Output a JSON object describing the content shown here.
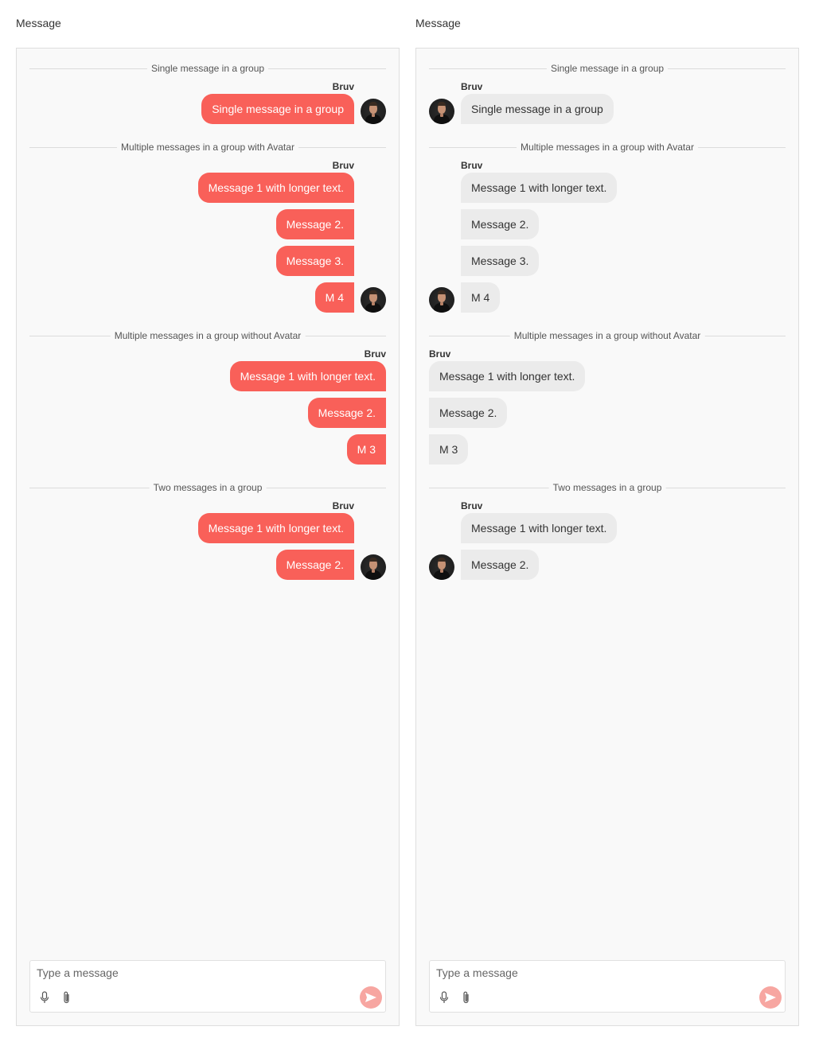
{
  "panels": [
    {
      "title": "Message",
      "variant": "outgoing",
      "sections": [
        {
          "divider": "Single message in a group",
          "name": "Bruv",
          "messages": [
            "Single message in a group"
          ],
          "avatar": true
        },
        {
          "divider": "Multiple messages in a group with Avatar",
          "name": "Bruv",
          "messages": [
            "Message 1 with longer text.",
            "Message 2.",
            "Message 3.",
            "M 4"
          ],
          "avatar": true
        },
        {
          "divider": "Multiple messages in a group without Avatar",
          "name": "Bruv",
          "messages": [
            "Message 1 with longer text.",
            "Message 2.",
            "M 3"
          ],
          "avatar": false
        },
        {
          "divider": "Two messages in a group",
          "name": "Bruv",
          "messages": [
            "Message 1 with longer text.",
            "Message 2."
          ],
          "avatar": true
        }
      ],
      "composer": {
        "placeholder": "Type a message"
      }
    },
    {
      "title": "Message",
      "variant": "incoming",
      "sections": [
        {
          "divider": "Single message in a group",
          "name": "Bruv",
          "messages": [
            "Single message in a group"
          ],
          "avatar": true
        },
        {
          "divider": "Multiple messages in a group with Avatar",
          "name": "Bruv",
          "messages": [
            "Message 1 with longer text.",
            "Message 2.",
            "Message 3.",
            "M 4"
          ],
          "avatar": true
        },
        {
          "divider": "Multiple messages in a group without Avatar",
          "name": "Bruv",
          "messages": [
            "Message 1 with longer text.",
            "Message 2.",
            "M 3"
          ],
          "avatar": false
        },
        {
          "divider": "Two messages in a group",
          "name": "Bruv",
          "messages": [
            "Message 1 with longer text.",
            "Message 2."
          ],
          "avatar": true
        }
      ],
      "composer": {
        "placeholder": "Type a message"
      }
    }
  ],
  "colors": {
    "outgoing_bubble": "#f96059",
    "incoming_bubble": "#ebebeb",
    "send_button": "#f7a6a1",
    "panel_background": "#f9f9f9"
  },
  "icons": {
    "mic": "microphone-icon",
    "attach": "paperclip-icon",
    "send": "send-icon"
  }
}
